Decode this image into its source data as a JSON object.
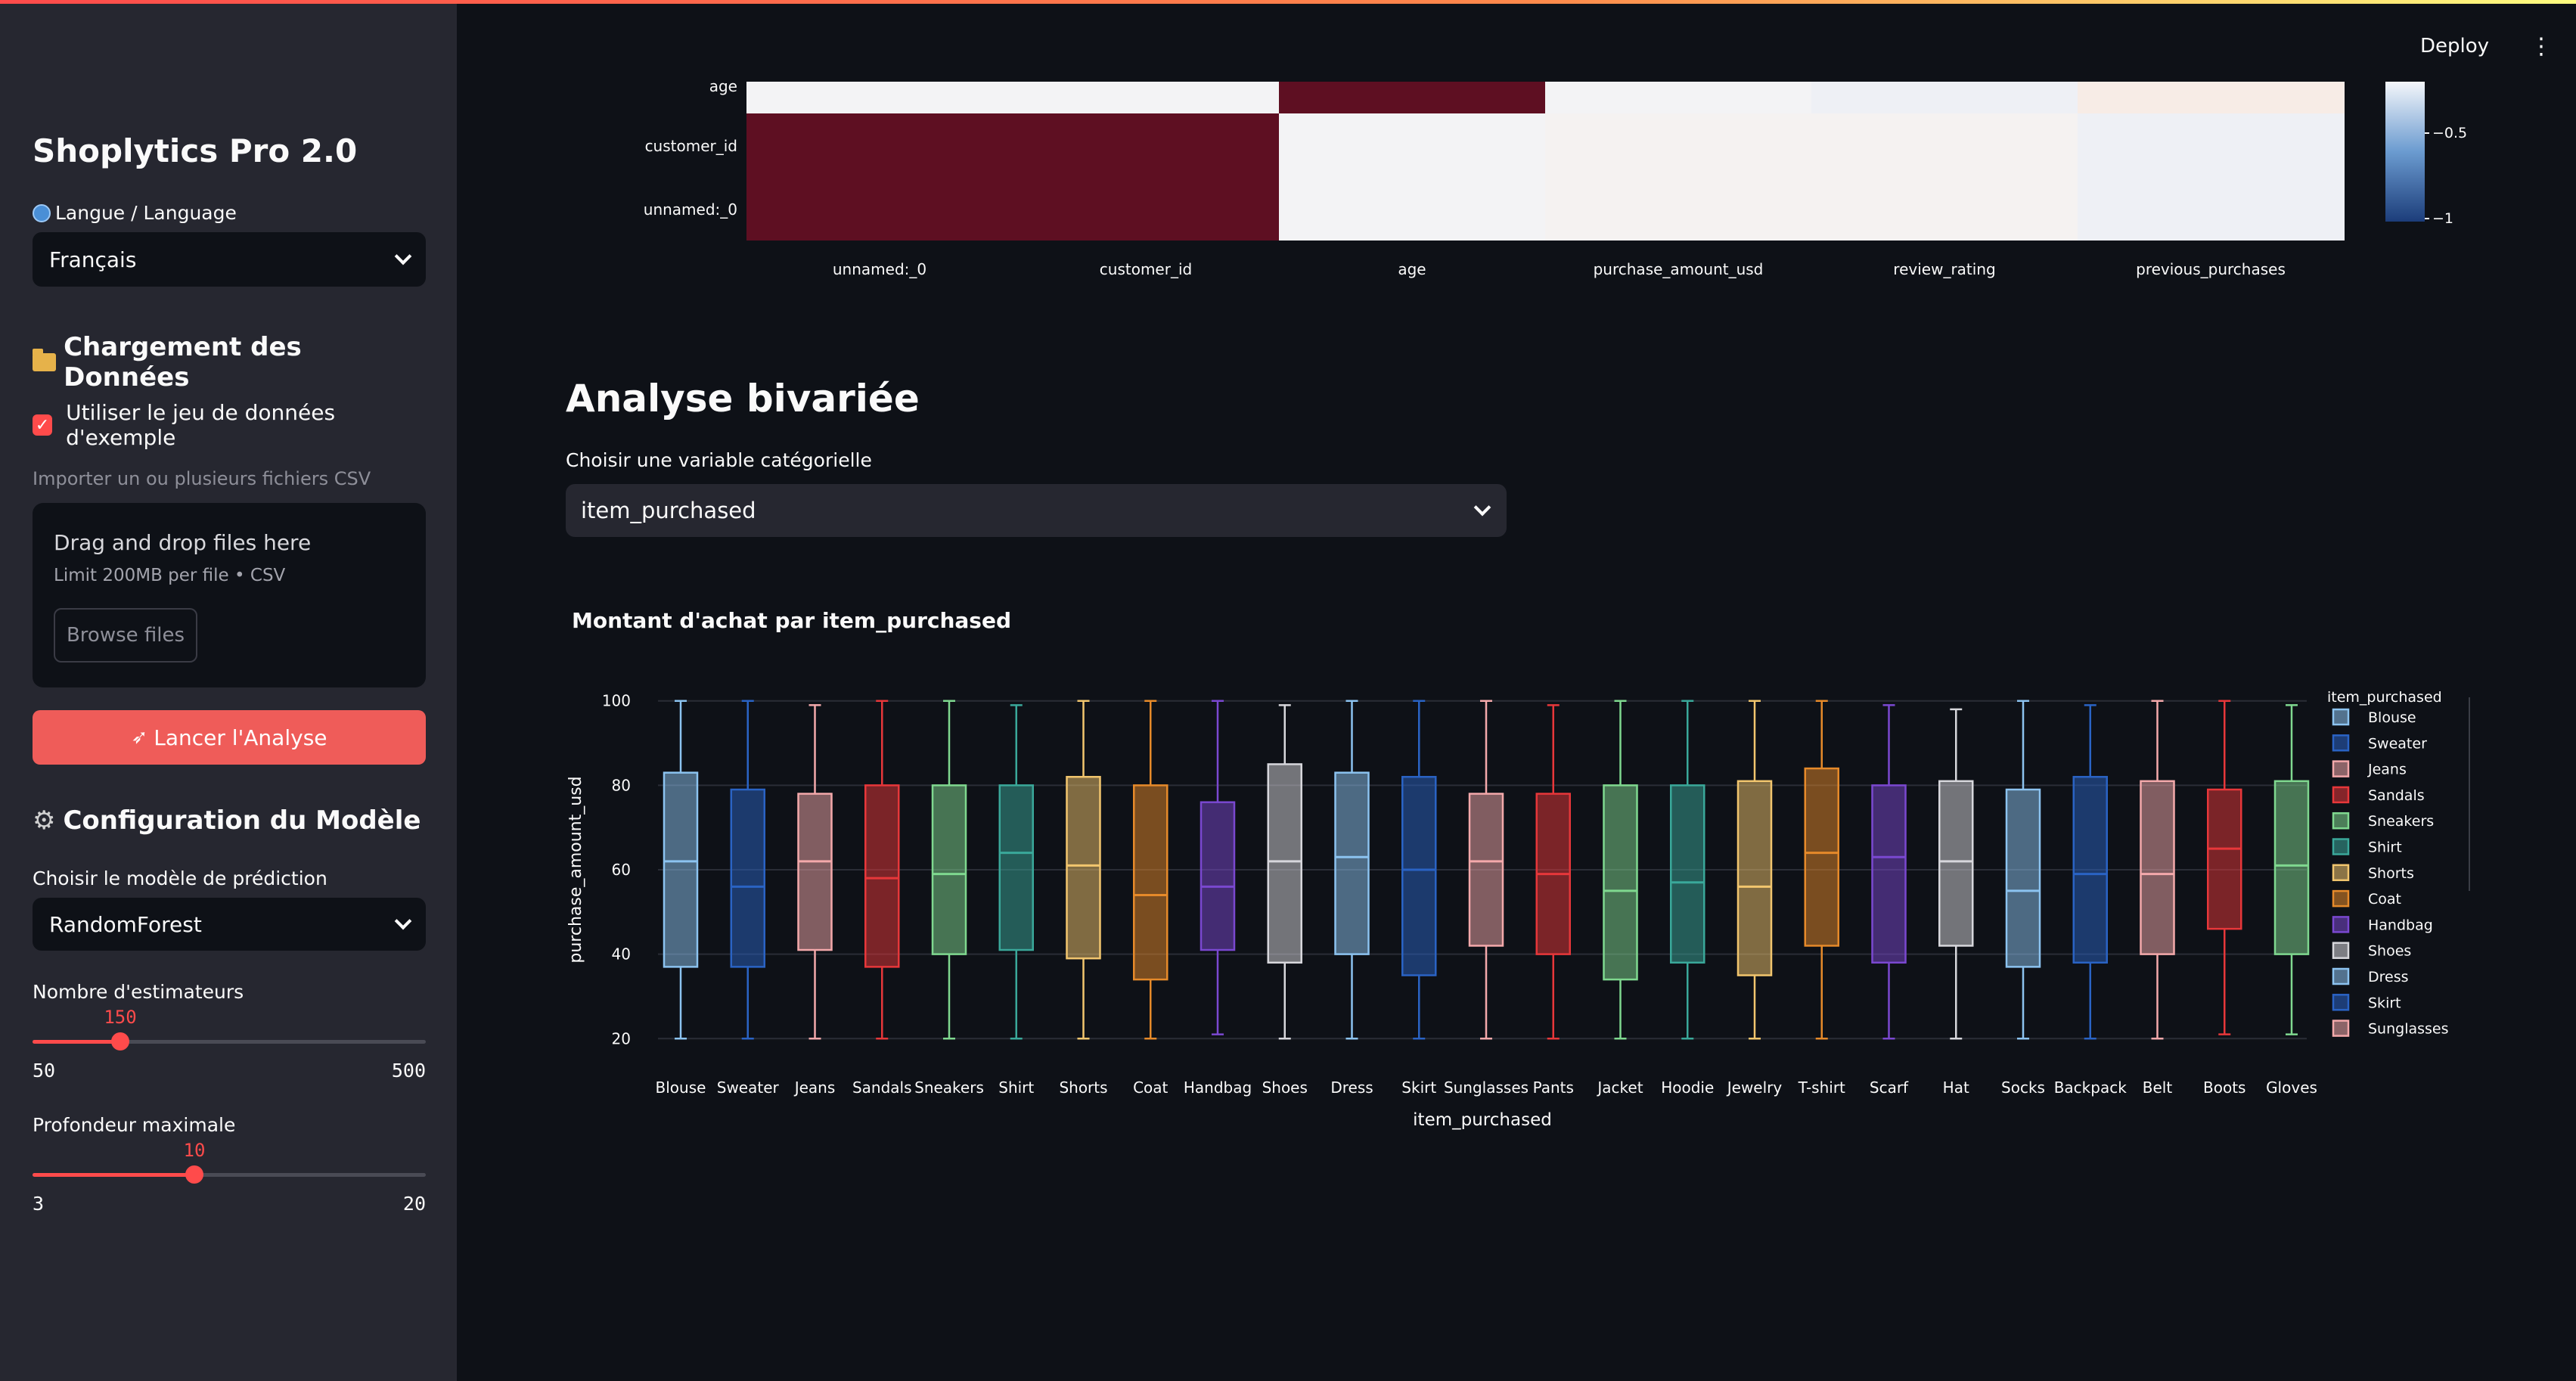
{
  "app": {
    "title": "Shoplytics Pro 2.0",
    "deploy_label": "Deploy"
  },
  "sidebar": {
    "language_label": "Langue / Language",
    "language_value": "Français",
    "data_section_title": "Chargement des Données",
    "sample_checkbox_label": "Utiliser le jeu de données d'exemple",
    "import_label": "Importer un ou plusieurs fichiers CSV",
    "dropzone_title": "Drag and drop files here",
    "dropzone_limit": "Limit 200MB per file • CSV",
    "browse_label": "Browse files",
    "run_label": "Lancer l'Analyse",
    "model_section_title": "Configuration du Modèle",
    "model_label": "Choisir le modèle de prédiction",
    "model_value": "RandomForest",
    "estimators": {
      "label": "Nombre d'estimateurs",
      "value": 150,
      "min": 50,
      "max": 500
    },
    "depth": {
      "label": "Profondeur maximale",
      "value": 10,
      "min": 3,
      "max": 20
    }
  },
  "main": {
    "bivariate_title": "Analyse bivariée",
    "cat_var_label": "Choisir une variable catégorielle",
    "cat_var_value": "item_purchased",
    "boxplot_title": "Montant d'achat par item_purchased"
  },
  "colors": {
    "accent": "#ff4b4b",
    "background": "#0e1117",
    "sidebar": "#262730"
  },
  "chart_data": [
    {
      "type": "heatmap",
      "x_labels": [
        "unnamed:_0",
        "customer_id",
        "age",
        "purchase_amount_usd",
        "review_rating",
        "previous_purchases"
      ],
      "y_labels_visible": [
        "age",
        "customer_id",
        "unnamed:_0"
      ],
      "colorbar_ticks": [
        "−0.5",
        "−1"
      ],
      "rows": {
        "age": [
          -0.01,
          -0.01,
          1.0,
          -0.01,
          -0.02,
          0.03
        ],
        "customer_id": [
          1.0,
          1.0,
          -0.01,
          0.01,
          0.0,
          -0.04
        ],
        "unnamed:_0": [
          1.0,
          1.0,
          -0.01,
          0.01,
          0.0,
          -0.04
        ]
      }
    },
    {
      "type": "box",
      "title": "Montant d'achat par item_purchased",
      "xlabel": "item_purchased",
      "ylabel": "purchase_amount_usd",
      "yticks": [
        20,
        40,
        60,
        80,
        100
      ],
      "ylim": [
        17,
        103
      ],
      "legend_title": "item_purchased",
      "legend_visible": [
        "Blouse",
        "Sweater",
        "Jeans",
        "Sandals",
        "Sneakers",
        "Shirt",
        "Shorts",
        "Coat",
        "Handbag",
        "Shoes",
        "Dress",
        "Skirt",
        "Sunglasses"
      ],
      "series": [
        {
          "name": "Blouse",
          "color": "#8cc3f0",
          "min": 20,
          "q1": 37,
          "median": 62,
          "q3": 83,
          "max": 100
        },
        {
          "name": "Sweater",
          "color": "#2a63c4",
          "min": 20,
          "q1": 37,
          "median": 56,
          "q3": 79,
          "max": 100
        },
        {
          "name": "Jeans",
          "color": "#f4a9ab",
          "min": 20,
          "q1": 41,
          "median": 62,
          "q3": 78,
          "max": 99
        },
        {
          "name": "Sandals",
          "color": "#e7373a",
          "min": 20,
          "q1": 37,
          "median": 58,
          "q3": 80,
          "max": 100
        },
        {
          "name": "Sneakers",
          "color": "#7fd88f",
          "min": 20,
          "q1": 40,
          "median": 59,
          "q3": 80,
          "max": 100
        },
        {
          "name": "Shirt",
          "color": "#3aa89a",
          "min": 20,
          "q1": 41,
          "median": 64,
          "q3": 80,
          "max": 99
        },
        {
          "name": "Shorts",
          "color": "#f2c66e",
          "min": 20,
          "q1": 39,
          "median": 61,
          "q3": 82,
          "max": 100
        },
        {
          "name": "Coat",
          "color": "#e68a2a",
          "min": 20,
          "q1": 34,
          "median": 54,
          "q3": 80,
          "max": 100
        },
        {
          "name": "Handbag",
          "color": "#7a48d0",
          "min": 21,
          "q1": 41,
          "median": 56,
          "q3": 76,
          "max": 100
        },
        {
          "name": "Shoes",
          "color": "#d7d7dc",
          "min": 20,
          "q1": 38,
          "median": 62,
          "q3": 85,
          "max": 99
        },
        {
          "name": "Dress",
          "color": "#8cc3f0",
          "min": 20,
          "q1": 40,
          "median": 63,
          "q3": 83,
          "max": 100
        },
        {
          "name": "Skirt",
          "color": "#2a63c4",
          "min": 20,
          "q1": 35,
          "median": 60,
          "q3": 82,
          "max": 100
        },
        {
          "name": "Sunglasses",
          "color": "#f4a9ab",
          "min": 20,
          "q1": 42,
          "median": 62,
          "q3": 78,
          "max": 100
        },
        {
          "name": "Pants",
          "color": "#e7373a",
          "min": 20,
          "q1": 40,
          "median": 59,
          "q3": 78,
          "max": 99
        },
        {
          "name": "Jacket",
          "color": "#7fd88f",
          "min": 20,
          "q1": 34,
          "median": 55,
          "q3": 80,
          "max": 100
        },
        {
          "name": "Hoodie",
          "color": "#3aa89a",
          "min": 20,
          "q1": 38,
          "median": 57,
          "q3": 80,
          "max": 100
        },
        {
          "name": "Jewelry",
          "color": "#f2c66e",
          "min": 20,
          "q1": 35,
          "median": 56,
          "q3": 81,
          "max": 100
        },
        {
          "name": "T-shirt",
          "color": "#e68a2a",
          "min": 20,
          "q1": 42,
          "median": 64,
          "q3": 84,
          "max": 100
        },
        {
          "name": "Scarf",
          "color": "#7a48d0",
          "min": 20,
          "q1": 38,
          "median": 63,
          "q3": 80,
          "max": 99
        },
        {
          "name": "Hat",
          "color": "#d7d7dc",
          "min": 20,
          "q1": 42,
          "median": 62,
          "q3": 81,
          "max": 98
        },
        {
          "name": "Socks",
          "color": "#8cc3f0",
          "min": 20,
          "q1": 37,
          "median": 55,
          "q3": 79,
          "max": 100
        },
        {
          "name": "Backpack",
          "color": "#2a63c4",
          "min": 20,
          "q1": 38,
          "median": 59,
          "q3": 82,
          "max": 99
        },
        {
          "name": "Belt",
          "color": "#f4a9ab",
          "min": 20,
          "q1": 40,
          "median": 59,
          "q3": 81,
          "max": 100
        },
        {
          "name": "Boots",
          "color": "#e7373a",
          "min": 21,
          "q1": 46,
          "median": 65,
          "q3": 79,
          "max": 100
        },
        {
          "name": "Gloves",
          "color": "#7fd88f",
          "min": 21,
          "q1": 40,
          "median": 61,
          "q3": 81,
          "max": 99
        }
      ]
    }
  ]
}
